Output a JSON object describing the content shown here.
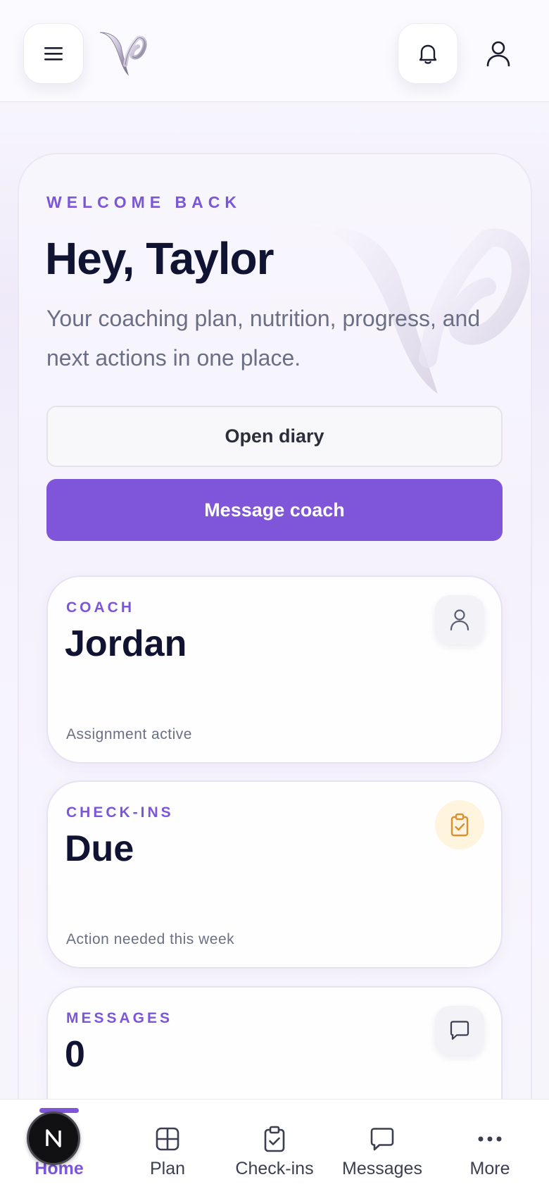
{
  "header": {
    "menu_icon": "hamburger-menu-icon",
    "logo": "v-brand-logo",
    "bell_icon": "bell-icon",
    "profile_icon": "user-icon"
  },
  "hero": {
    "eyebrow": "WELCOME BACK",
    "title": "Hey, Taylor",
    "subtitle": "Your coaching plan, nutrition, progress, and next actions in one place.",
    "open_diary_label": "Open diary",
    "message_coach_label": "Message coach"
  },
  "cards": [
    {
      "label": "COACH",
      "value": "Jordan",
      "footer": "Assignment active",
      "icon": "user-icon"
    },
    {
      "label": "CHECK-INS",
      "value": "Due",
      "footer": "Action needed this week",
      "icon": "clipboard-check-icon"
    },
    {
      "label": "MESSAGES",
      "value": "0",
      "icon": "chat-bubble-icon"
    }
  ],
  "nav": {
    "items": [
      {
        "label": "Home",
        "icon": "home-icon",
        "active": true
      },
      {
        "label": "Plan",
        "icon": "grid-icon"
      },
      {
        "label": "Check-ins",
        "icon": "clipboard-check-icon"
      },
      {
        "label": "Messages",
        "icon": "chat-bubble-icon"
      },
      {
        "label": "More",
        "icon": "more-dots-icon"
      }
    ]
  },
  "overlay_badge": {
    "letter": "N"
  },
  "colors": {
    "accent": "#7f56d9",
    "text_dark": "#101432",
    "text_muted": "#6b6f86",
    "warning_bg": "#fff4de",
    "warning_icon": "#d9902f"
  }
}
